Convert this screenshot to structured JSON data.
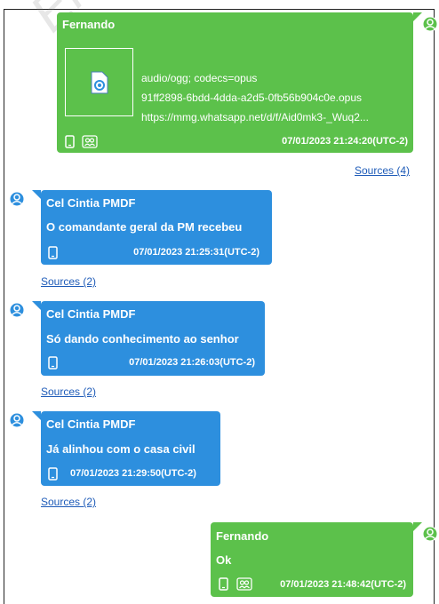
{
  "watermark": "Em.C",
  "messages": [
    {
      "sender": "Fernando",
      "attachment": {
        "mime": "audio/ogg; codecs=opus",
        "filename": "91ff2898-6bdd-4dda-a2d5-0fb56b904c0e.opus",
        "url": "https://mmg.whatsapp.net/d/f/Aid0mk3-_Wuq2..."
      },
      "timestamp": "07/01/2023 21:24:20(UTC-2)",
      "sources": "Sources (4)"
    },
    {
      "sender": "Cel Cintia PMDF",
      "text": "O comandante geral da PM recebeu",
      "timestamp": "07/01/2023 21:25:31(UTC-2)",
      "sources": "Sources (2)"
    },
    {
      "sender": "Cel Cintia PMDF",
      "text": "Só dando conhecimento ao senhor",
      "timestamp": "07/01/2023 21:26:03(UTC-2)",
      "sources": "Sources (2)"
    },
    {
      "sender": "Cel Cintia PMDF",
      "text": "Já alinhou com o casa civil",
      "timestamp": "07/01/2023 21:29:50(UTC-2)",
      "sources": "Sources (2)"
    },
    {
      "sender": "Fernando",
      "text": "Ok",
      "timestamp": "07/01/2023 21:48:42(UTC-2)"
    }
  ],
  "colors": {
    "outgoing": "#5cc14b",
    "incoming": "#2d8fde",
    "link": "#1e5bb8"
  }
}
